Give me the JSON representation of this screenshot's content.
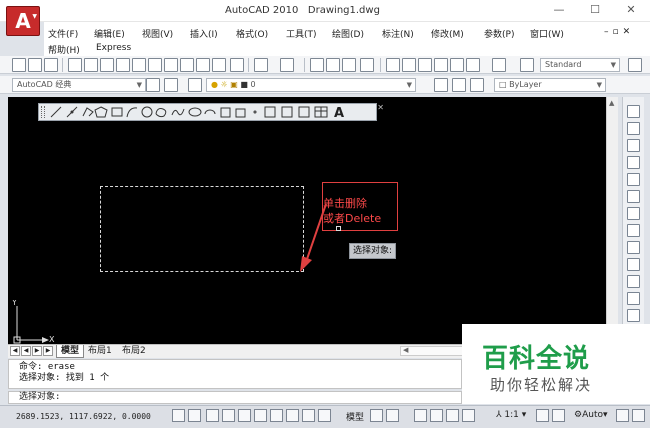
{
  "app": {
    "title": "AutoCAD 2010",
    "document": "Drawing1.dwg"
  },
  "menu": [
    "文件(F)",
    "编辑(E)",
    "视图(V)",
    "插入(I)",
    "格式(O)",
    "工具(T)",
    "绘图(D)",
    "标注(N)",
    "修改(M)",
    "参数(P)",
    "窗口(W)",
    "帮助(H)",
    "Express"
  ],
  "toolbar": {
    "workspace": "AutoCAD 经典",
    "text_style": "Standard",
    "layer": "0",
    "color": "ByLayer"
  },
  "annotation": {
    "line1": "单击删除",
    "line2": "或者Delete"
  },
  "tooltip": "选择对象:",
  "layout_tabs": {
    "model": "模型",
    "layout1": "布局1",
    "layout2": "布局2"
  },
  "command": {
    "history1": "命令:  erase",
    "history2": "选择对象: 找到 1 个",
    "prompt": "选择对象:"
  },
  "status": {
    "coords": "2689.1523, 1117.6922, 0.0000",
    "model": "模型",
    "scale": "1:1",
    "auto": "Auto"
  },
  "ucs": {
    "x": "X",
    "y": "Y"
  },
  "watermark": {
    "title": "百科全说",
    "subtitle": "助你轻松解决"
  },
  "colors": {
    "canvas": "#000000",
    "annotation": "#e04040",
    "watermark": "#1f9d4a"
  }
}
